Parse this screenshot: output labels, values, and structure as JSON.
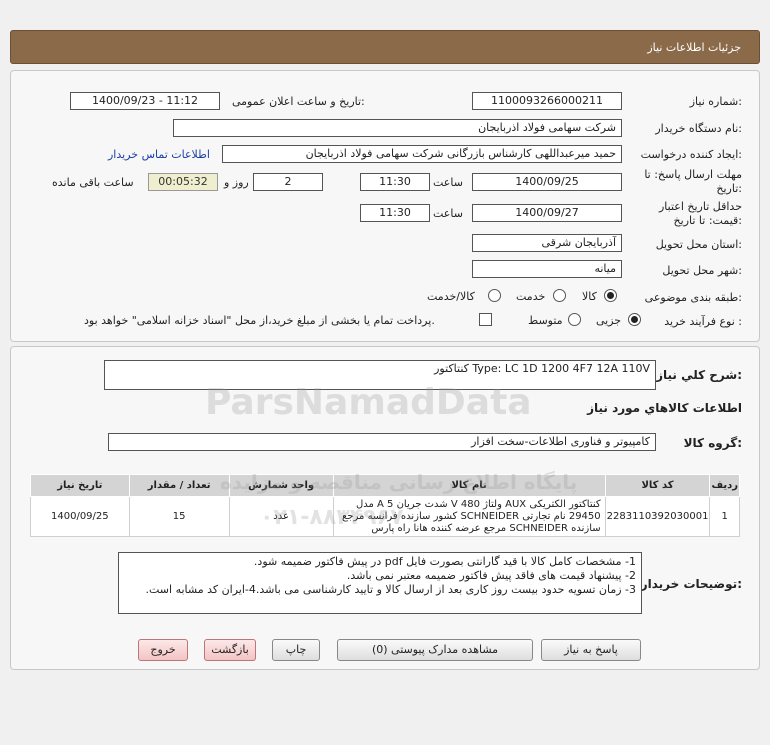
{
  "header": {
    "title": "جزئیات اطلاعات نیاز"
  },
  "form": {
    "need_number": {
      "label": "شماره نیاز:",
      "value": "1100093266000211"
    },
    "announce_datetime": {
      "label": "تاریخ و ساعت اعلان عمومی:",
      "value": "1400/09/23 - 11:12"
    },
    "buyer_org": {
      "label": "نام دستگاه خریدار:",
      "value": "شرکت سهامی فولاد اذربایجان"
    },
    "requester": {
      "label": "ایجاد کننده درخواست:",
      "value": "حمید میرعبداللهی کارشناس بازرگانی شرکت سهامی فولاد اذربایجان"
    },
    "contact_link": "اطلاعات تماس خریدار",
    "reply_deadline": {
      "label_line1": "مهلت ارسال پاسخ: تا",
      "label_line2": "تاریخ:",
      "date": "1400/09/25",
      "time_label": "ساعت",
      "time": "11:30",
      "days": "2",
      "days_label": "روز و",
      "remaining": "00:05:32",
      "remaining_label": "ساعت باقی مانده"
    },
    "price_validity": {
      "label_line1": "حداقل تاریخ اعتبار",
      "label_line2": "قیمت: تا تاریخ:",
      "date": "1400/09/27",
      "time_label": "ساعت",
      "time": "11:30"
    },
    "delivery_province": {
      "label": "استان محل تحویل:",
      "value": "آذربایجان شرقی"
    },
    "delivery_city": {
      "label": "شهر محل تحویل:",
      "value": "میانه"
    },
    "category": {
      "label": "طبقه بندی موضوعی:",
      "options": [
        "کالا",
        "خدمت",
        "کالا/خدمت"
      ],
      "selected": "کالا"
    },
    "purchase_process": {
      "label": "نوع فرآیند خرید :",
      "options": [
        "جزیی",
        "متوسط"
      ],
      "selected": "جزیی",
      "checkbox_text": "پرداخت تمام یا بخشی از مبلغ خرید،از محل \"اسناد خزانه اسلامی\" خواهد بود."
    }
  },
  "details": {
    "summary_label": "شرح کلي نیاز:",
    "summary_value": "کنتاکتور Type: LC 1D 1200 4F7 12A 110V",
    "items_title": "اطلاعات کالاهاي مورد نیاز",
    "group_label": "گروه کالا:",
    "group_value": "کامپیوتر و فناوری اطلاعات-سخت افزار",
    "table": {
      "headers": [
        "ردیف",
        "کد کالا",
        "نام کالا",
        "واحد شمارش",
        "تعداد / مقدار",
        "تاریخ نیاز"
      ],
      "rows": [
        {
          "row": "1",
          "code": "2283110392030001",
          "name": "کنتاکتور الکتریکی AUX ولتاژ 480 V شدت جریان 5 A مدل 29450 نام تجارتی SCHNEIDER کشور سازنده فرانسه مرجع سازنده SCHNEIDER مرجع عرضه کننده هانا راه پارس",
          "unit": "عدد",
          "qty": "15",
          "date": "1400/09/25"
        }
      ]
    },
    "notes_label": "توضیحات خریدار:",
    "notes": [
      "1- مشخصات کامل کالا با قید گارانتی بصورت فایل pdf در پیش فاکتور ضمیمه شود.",
      "2- پیشنهاد قیمت های فاقد پیش فاکتور ضمیمه معتبر نمی باشد.",
      "3- زمان تسویه حدود بیست روز کاری بعد از ارسال کالا و تایید کارشناسی می باشد.4-ایران کد مشابه است."
    ]
  },
  "buttons": {
    "reply": "پاسخ به نیاز",
    "view_docs": "مشاهده مدارک پیوستی (0)",
    "print": "چاپ",
    "back": "بازگشت",
    "exit": "خروج"
  },
  "watermark": {
    "brand": "ParsNamadData",
    "sub": "پایگاه اطلاع رسانی مناقصه و مزایده",
    "phone": "۰۲۱-۸۸۳۴۹۶۷۰"
  }
}
